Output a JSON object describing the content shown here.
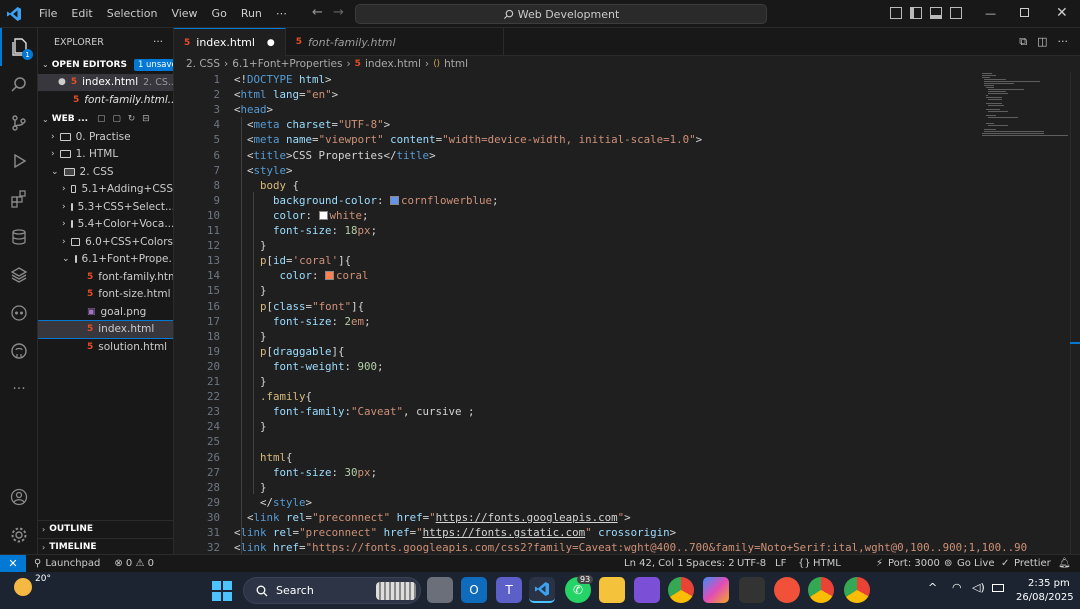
{
  "titlebar": {
    "menu": [
      "File",
      "Edit",
      "Selection",
      "View",
      "Go",
      "Run",
      "⋯"
    ],
    "search": "Web Development"
  },
  "sidebar": {
    "title": "EXPLORER",
    "open_editors": "OPEN EDITORS",
    "unsaved_badge": "1 unsaved",
    "open_files": [
      {
        "name": "index.html",
        "hint": "2. CS..."
      },
      {
        "name": "font-family.html...",
        "hint": ""
      }
    ],
    "workspace": "WEB ...",
    "tree": [
      {
        "label": "0. Practise",
        "type": "folder",
        "level": 1
      },
      {
        "label": "1. HTML",
        "type": "folder",
        "level": 1
      },
      {
        "label": "2. CSS",
        "type": "folder-open",
        "level": 1
      },
      {
        "label": "5.1+Adding+CSS",
        "type": "folder",
        "level": 2
      },
      {
        "label": "5.3+CSS+Select...",
        "type": "folder",
        "level": 2
      },
      {
        "label": "5.4+Color+Voca...",
        "type": "folder",
        "level": 2
      },
      {
        "label": "6.0+CSS+Colors",
        "type": "folder",
        "level": 2
      },
      {
        "label": "6.1+Font+Prope...",
        "type": "folder-open",
        "level": 2
      },
      {
        "label": "font-family.html",
        "type": "html",
        "level": 3
      },
      {
        "label": "font-size.html",
        "type": "html",
        "level": 3
      },
      {
        "label": "goal.png",
        "type": "png",
        "level": 3
      },
      {
        "label": "index.html",
        "type": "html",
        "level": 3
      },
      {
        "label": "solution.html",
        "type": "html",
        "level": 3
      }
    ],
    "outline": "OUTLINE",
    "timeline": "TIMELINE"
  },
  "tabs": [
    {
      "label": "index.html",
      "active": true
    },
    {
      "label": "font-family.html",
      "active": false
    }
  ],
  "breadcrumb": [
    "2. CSS",
    "6.1+Font+Properties",
    "index.html",
    "html"
  ],
  "colors": {
    "accent": "#0078d4",
    "cornflowerblue": "#6495ed",
    "white": "#ffffff",
    "coral": "#ff7f50"
  },
  "code": [
    {
      "n": "1",
      "s": [
        [
          "br",
          "<!"
        ],
        [
          "tg",
          "DOCTYPE"
        ],
        [
          "at",
          " html"
        ],
        [
          "br",
          ">"
        ]
      ]
    },
    {
      "n": "2",
      "s": [
        [
          "br",
          "<"
        ],
        [
          "tg",
          "html"
        ],
        [
          "at",
          " lang"
        ],
        [
          "br",
          "="
        ],
        [
          "st",
          "\"en\""
        ],
        [
          "br",
          ">"
        ]
      ]
    },
    {
      "n": "3",
      "s": [
        [
          "br",
          "<"
        ],
        [
          "tg",
          "head"
        ],
        [
          "br",
          ">"
        ]
      ]
    },
    {
      "n": "4",
      "s": [
        [
          "br",
          "  <"
        ],
        [
          "tg",
          "meta"
        ],
        [
          "at",
          " charset"
        ],
        [
          "br",
          "="
        ],
        [
          "st",
          "\"UTF-8\""
        ],
        [
          "br",
          ">"
        ]
      ]
    },
    {
      "n": "5",
      "s": [
        [
          "br",
          "  <"
        ],
        [
          "tg",
          "meta"
        ],
        [
          "at",
          " name"
        ],
        [
          "br",
          "="
        ],
        [
          "st",
          "\"viewport\""
        ],
        [
          "at",
          " content"
        ],
        [
          "br",
          "="
        ],
        [
          "st",
          "\"width=device-width, initial-scale=1.0\""
        ],
        [
          "br",
          ">"
        ]
      ]
    },
    {
      "n": "6",
      "s": [
        [
          "br",
          "  <"
        ],
        [
          "tg",
          "title"
        ],
        [
          "br",
          ">CSS Properties</"
        ],
        [
          "tg",
          "title"
        ],
        [
          "br",
          ">"
        ]
      ]
    },
    {
      "n": "7",
      "s": [
        [
          "br",
          "  <"
        ],
        [
          "tg",
          "style"
        ],
        [
          "br",
          ">"
        ]
      ]
    },
    {
      "n": "8",
      "s": [
        [
          "se",
          "    body"
        ],
        [
          "br",
          " {"
        ]
      ]
    },
    {
      "n": "9",
      "s": [
        [
          "pr",
          "      background-color"
        ],
        [
          "br",
          ": "
        ],
        [
          "sw",
          "cornflowerblue"
        ],
        [
          "kw",
          "cornflowerblue"
        ],
        [
          "br",
          ";"
        ]
      ]
    },
    {
      "n": "10",
      "s": [
        [
          "pr",
          "      color"
        ],
        [
          "br",
          ": "
        ],
        [
          "sw",
          "white"
        ],
        [
          "kw",
          "white"
        ],
        [
          "br",
          ";"
        ]
      ]
    },
    {
      "n": "11",
      "s": [
        [
          "pr",
          "      font-size"
        ],
        [
          "br",
          ": "
        ],
        [
          "nu",
          "18"
        ],
        [
          "un",
          "px"
        ],
        [
          "br",
          ";"
        ]
      ]
    },
    {
      "n": "12",
      "s": [
        [
          "br",
          "    }"
        ]
      ]
    },
    {
      "n": "13",
      "s": [
        [
          "se",
          "    p"
        ],
        [
          "br",
          "["
        ],
        [
          "at",
          "id"
        ],
        [
          "br",
          "="
        ],
        [
          "st",
          "'coral'"
        ],
        [
          "br",
          "]{"
        ]
      ]
    },
    {
      "n": "14",
      "s": [
        [
          "pr",
          "       color"
        ],
        [
          "br",
          ": "
        ],
        [
          "sw",
          "coral"
        ],
        [
          "kw",
          "coral"
        ]
      ]
    },
    {
      "n": "15",
      "s": [
        [
          "br",
          "    }"
        ]
      ]
    },
    {
      "n": "16",
      "s": [
        [
          "se",
          "    p"
        ],
        [
          "br",
          "["
        ],
        [
          "at",
          "class"
        ],
        [
          "br",
          "="
        ],
        [
          "st",
          "\"font\""
        ],
        [
          "br",
          "]{"
        ]
      ]
    },
    {
      "n": "17",
      "s": [
        [
          "pr",
          "      font-size"
        ],
        [
          "br",
          ": "
        ],
        [
          "nu",
          "2"
        ],
        [
          "un",
          "em"
        ],
        [
          "br",
          ";"
        ]
      ]
    },
    {
      "n": "18",
      "s": [
        [
          "br",
          "    }"
        ]
      ]
    },
    {
      "n": "19",
      "s": [
        [
          "se",
          "    p"
        ],
        [
          "br",
          "["
        ],
        [
          "at",
          "draggable"
        ],
        [
          "br",
          "]{"
        ]
      ]
    },
    {
      "n": "20",
      "s": [
        [
          "pr",
          "      font-weight"
        ],
        [
          "br",
          ": "
        ],
        [
          "nu",
          "900"
        ],
        [
          "br",
          ";"
        ]
      ]
    },
    {
      "n": "21",
      "s": [
        [
          "br",
          "    }"
        ]
      ]
    },
    {
      "n": "22",
      "s": [
        [
          "se",
          "    .family"
        ],
        [
          "br",
          "{"
        ]
      ]
    },
    {
      "n": "23",
      "s": [
        [
          "pr",
          "      font-family"
        ],
        [
          "br",
          ":"
        ],
        [
          "st",
          "\"Caveat\""
        ],
        [
          "br",
          ", cursive ;"
        ]
      ]
    },
    {
      "n": "24",
      "s": [
        [
          "br",
          "    }"
        ]
      ]
    },
    {
      "n": "25",
      "s": [
        [
          "br",
          ""
        ]
      ]
    },
    {
      "n": "26",
      "s": [
        [
          "se",
          "    html"
        ],
        [
          "br",
          "{"
        ]
      ]
    },
    {
      "n": "27",
      "s": [
        [
          "pr",
          "      font-size"
        ],
        [
          "br",
          ": "
        ],
        [
          "nu",
          "30"
        ],
        [
          "un",
          "px"
        ],
        [
          "br",
          ";"
        ]
      ]
    },
    {
      "n": "28",
      "s": [
        [
          "br",
          "    }"
        ]
      ]
    },
    {
      "n": "29",
      "s": [
        [
          "br",
          "    </"
        ],
        [
          "tg",
          "style"
        ],
        [
          "br",
          ">"
        ]
      ]
    },
    {
      "n": "30",
      "s": [
        [
          "br",
          "  <"
        ],
        [
          "tg",
          "link"
        ],
        [
          "at",
          " rel"
        ],
        [
          "br",
          "="
        ],
        [
          "st",
          "\"preconnect\""
        ],
        [
          "at",
          " href"
        ],
        [
          "br",
          "="
        ],
        [
          "st",
          "\""
        ],
        [
          "ul",
          "https://fonts.googleapis.com"
        ],
        [
          "st",
          "\""
        ],
        [
          "br",
          ">"
        ]
      ]
    },
    {
      "n": "31",
      "s": [
        [
          "br",
          "<"
        ],
        [
          "tg",
          "link"
        ],
        [
          "at",
          " rel"
        ],
        [
          "br",
          "="
        ],
        [
          "st",
          "\"preconnect\""
        ],
        [
          "at",
          " href"
        ],
        [
          "br",
          "="
        ],
        [
          "st",
          "\""
        ],
        [
          "ul",
          "https://fonts.gstatic.com"
        ],
        [
          "st",
          "\""
        ],
        [
          "at",
          " crossorigin"
        ],
        [
          "br",
          ">"
        ]
      ]
    },
    {
      "n": "32",
      "s": [
        [
          "br",
          "<"
        ],
        [
          "tg",
          "link"
        ],
        [
          "at",
          " href"
        ],
        [
          "br",
          "="
        ],
        [
          "st",
          "\"https://fonts.googleapis.com/css2?family=Caveat:wght@400..700&family=Noto+Serif:ital,wght@0,100..900;1,100..90"
        ]
      ]
    }
  ],
  "status": {
    "launchpad": "Launchpad",
    "problems": "⊗ 0 ⚠ 0",
    "position": "Ln 42, Col 1",
    "spaces": "Spaces: 2",
    "encoding": "UTF-8",
    "eol": "LF",
    "language": "HTML",
    "port": "Port: 3000",
    "golive": "Go Live",
    "prettier": "Prettier"
  },
  "taskbar": {
    "weather": "20°",
    "search": "Search",
    "time": "2:35 pm",
    "date": "26/08/2025",
    "whatsapp_badge": "93"
  }
}
